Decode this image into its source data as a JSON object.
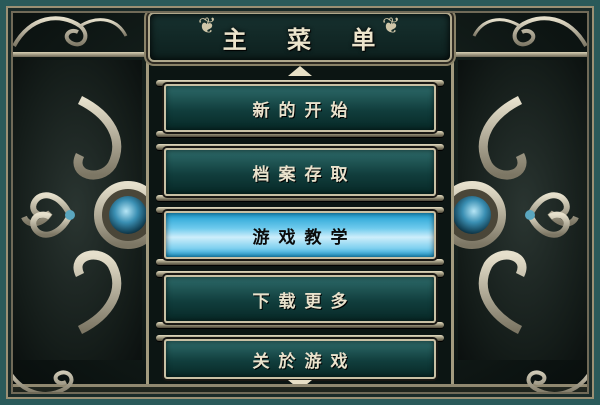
{
  "title": "主 菜 单",
  "menu": {
    "items": [
      {
        "label": "新的开始",
        "selected": false
      },
      {
        "label": "档案存取",
        "selected": false
      },
      {
        "label": "游戏教学",
        "selected": true
      },
      {
        "label": "下载更多",
        "selected": false
      },
      {
        "label": "关於游戏",
        "selected": false
      }
    ]
  },
  "colors": {
    "frame_teal": "#2a5a5a",
    "item_bg": "#113e3d",
    "item_selected": "#6fcbed",
    "ornament_silver": "#b8b29c",
    "gem_blue": "#3a8fb3"
  },
  "icons": [
    "scroll-ornament-icon",
    "fleur-de-lis-icon",
    "gem-icon",
    "scroll-up-arrow-icon",
    "scroll-down-arrow-icon"
  ]
}
